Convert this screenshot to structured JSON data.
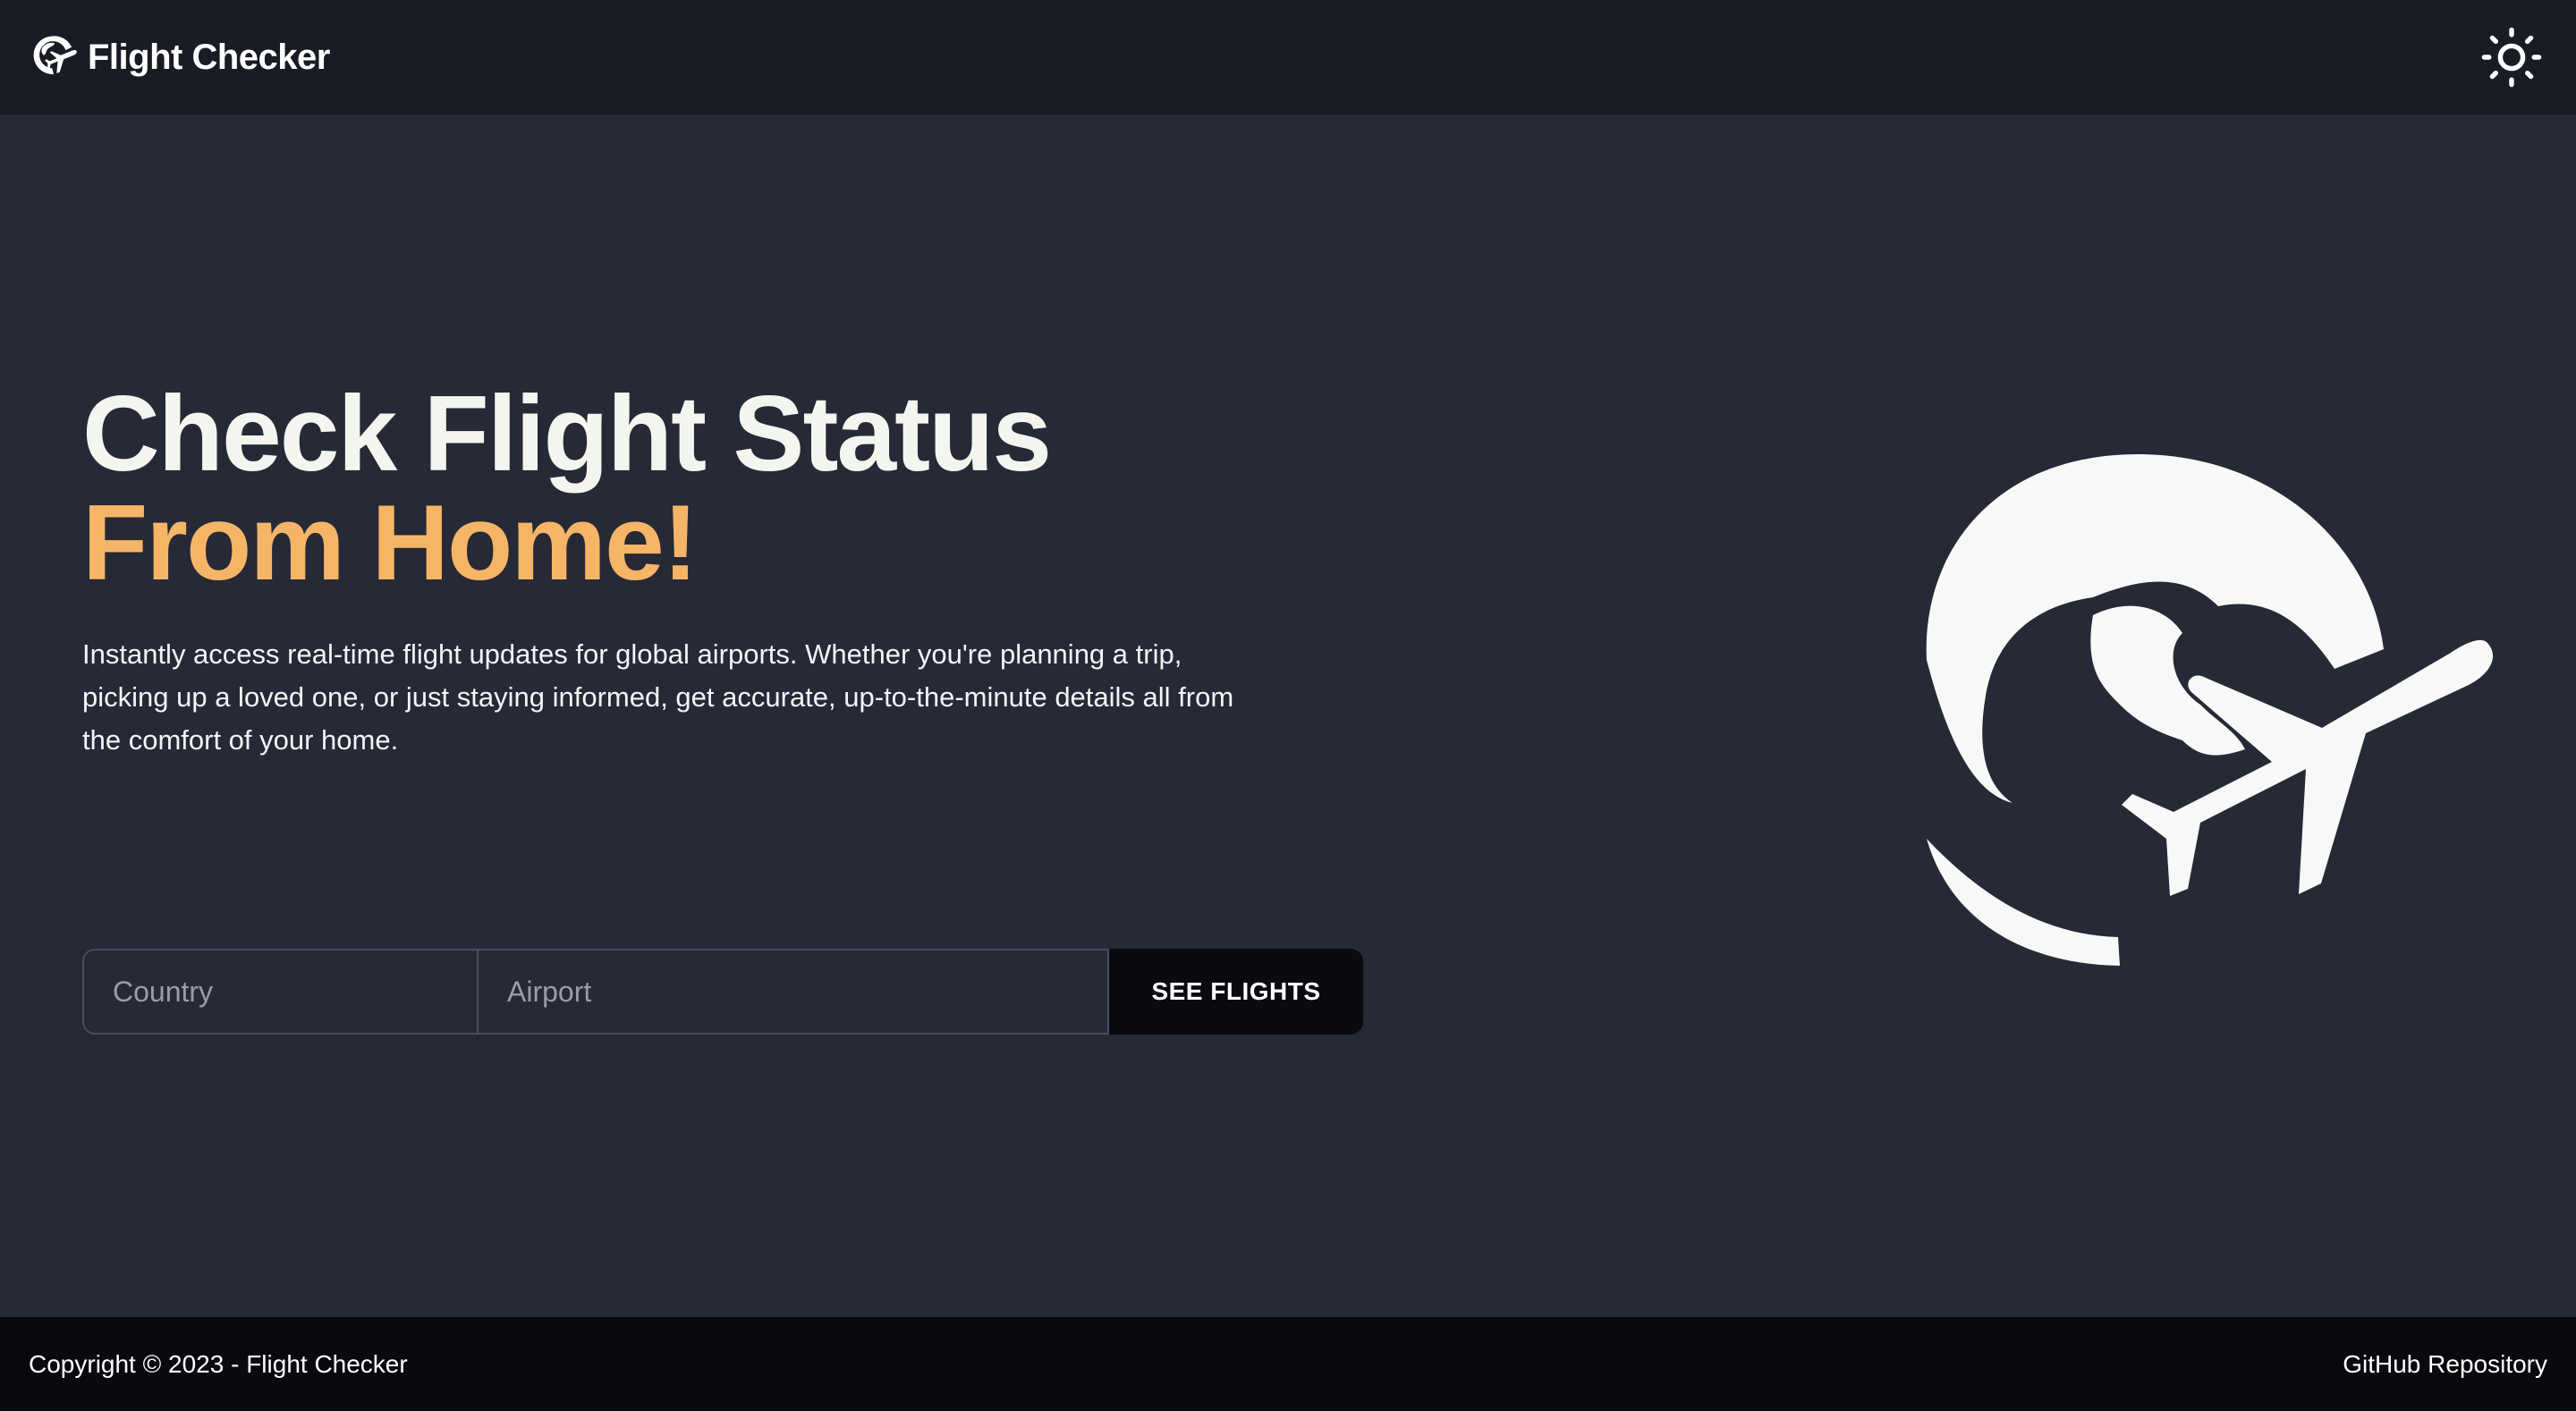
{
  "header": {
    "brand_name": "Flight Checker",
    "brand_icon": "globe-airplane-icon",
    "theme_toggle_icon": "sun-icon"
  },
  "hero": {
    "title_line1": "Check Flight Status",
    "title_line2": "From Home!",
    "description": "Instantly access real-time flight updates for global airports. Whether you're planning a trip, picking up a loved one, or just staying informed, get accurate, up-to-the-minute details all from the comfort of your home.",
    "illustration_icon": "globe-airplane-icon"
  },
  "search": {
    "country_placeholder": "Country",
    "country_value": "",
    "airport_placeholder": "Airport",
    "airport_value": "",
    "submit_label": "SEE FLIGHTS"
  },
  "footer": {
    "copyright": "Copyright © 2023 - Flight Checker",
    "github_link": "GitHub Repository"
  },
  "colors": {
    "page_background": "#262936",
    "header_background": "#191b25",
    "footer_background": "#0a0a0e",
    "accent": "#f6b566",
    "title_text": "#f5f5f0",
    "button_background": "#0b0b0f"
  }
}
